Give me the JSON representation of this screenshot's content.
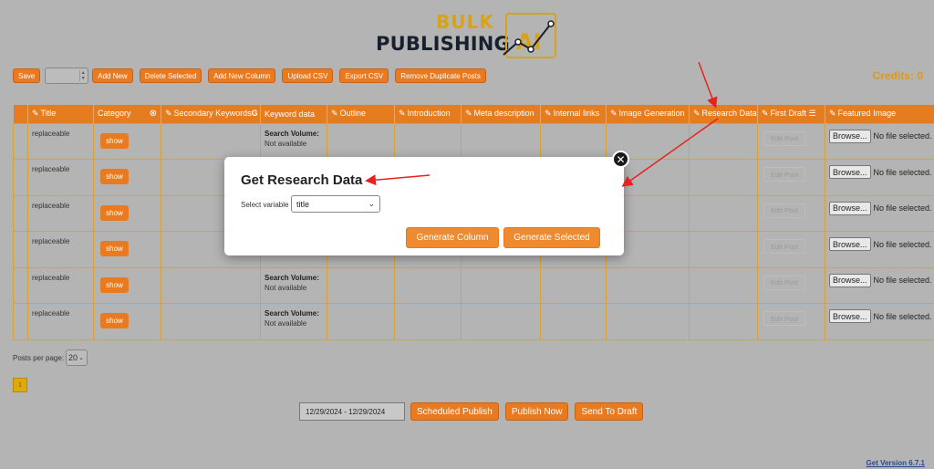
{
  "logo": {
    "bulk": "BULK",
    "publishing": "PUBLISHING",
    "ai": "AI"
  },
  "toolbar": {
    "save": "Save",
    "add_new": "Add New",
    "delete_selected": "Delete Selected",
    "add_new_column": "Add New Column",
    "upload_csv": "Upload CSV",
    "export_csv": "Export CSV",
    "remove_duplicates": "Remove Duplicate Posts"
  },
  "credits": "Credits: 0",
  "table": {
    "headers": [
      "Title",
      "Category",
      "Secondary Keywords",
      "Keyword data",
      "Outline",
      "Introduction",
      "Meta description",
      "Internal links",
      "Image Generation",
      "Research Data",
      "First Draft",
      "Featured Image"
    ],
    "rows": [
      {
        "title": "replaceable",
        "category": "show",
        "sv_label": "Search Volume:",
        "sv_value": "Not available",
        "edit": "Edit Post",
        "browse": "Browse...",
        "nofile": "No file selected."
      },
      {
        "title": "replaceable",
        "category": "show",
        "sv_label": "",
        "sv_value": "",
        "edit": "Edit Post",
        "browse": "Browse...",
        "nofile": "No file selected."
      },
      {
        "title": "replaceable",
        "category": "show",
        "sv_label": "",
        "sv_value": "",
        "edit": "Edit Post",
        "browse": "Browse...",
        "nofile": "No file selected."
      },
      {
        "title": "replaceable",
        "category": "show",
        "sv_label": "",
        "sv_value": "",
        "edit": "Edit Post",
        "browse": "Browse...",
        "nofile": "No file selected."
      },
      {
        "title": "replaceable",
        "category": "show",
        "sv_label": "Search Volume:",
        "sv_value": "Not available",
        "edit": "Edit Post",
        "browse": "Browse...",
        "nofile": "No file selected."
      },
      {
        "title": "replaceable",
        "category": "show",
        "sv_label": "Search Volume:",
        "sv_value": "Not available",
        "edit": "Edit Post",
        "browse": "Browse...",
        "nofile": "No file selected."
      }
    ]
  },
  "pagination": {
    "per_page_label": "Posts per page:",
    "per_page_value": "20",
    "current_page": "1"
  },
  "bottom": {
    "date_range": "12/29/2024 - 12/29/2024",
    "scheduled_publish": "Scheduled Publish",
    "publish_now": "Publish Now",
    "send_to_draft": "Send To Draft"
  },
  "version": "Get Version 6.7.1",
  "modal": {
    "title": "Get Research Data",
    "select_label": "Select variable",
    "select_value": "title",
    "generate_column": "Generate Column",
    "generate_selected": "Generate Selected"
  },
  "colors": {
    "accent": "#ea7a20",
    "credits": "#d79a28",
    "gold": "#d8a21a",
    "arrow": "#e8211d"
  }
}
